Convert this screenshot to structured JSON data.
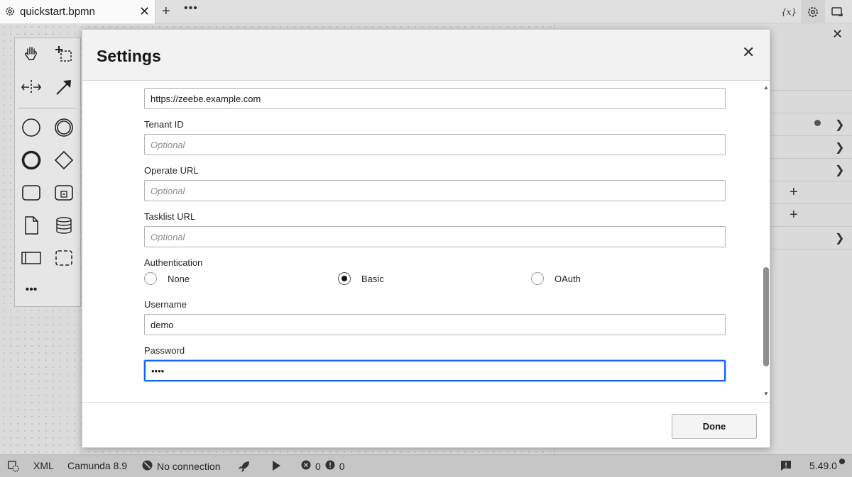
{
  "tab": {
    "title": "quickstart.bpmn",
    "icon": "gear-tab-icon"
  },
  "toolbar": {
    "variables_label": "{x}"
  },
  "modal": {
    "title": "Settings",
    "fields": {
      "cluster_url": {
        "value": "https://zeebe.example.com"
      },
      "tenant_id": {
        "label": "Tenant ID",
        "placeholder": "Optional",
        "value": ""
      },
      "operate_url": {
        "label": "Operate URL",
        "placeholder": "Optional",
        "value": ""
      },
      "tasklist_url": {
        "label": "Tasklist URL",
        "placeholder": "Optional",
        "value": ""
      },
      "authentication": {
        "label": "Authentication",
        "options": [
          "None",
          "Basic",
          "OAuth"
        ],
        "selected": "Basic"
      },
      "username": {
        "label": "Username",
        "value": "demo"
      },
      "password": {
        "label": "Password",
        "value": "demo"
      }
    },
    "done_label": "Done"
  },
  "statusbar": {
    "xml_label": "XML",
    "engine_label": "Camunda 8.9",
    "connection_label": "No connection",
    "errors": "0",
    "warnings": "0",
    "version": "5.49.0"
  }
}
